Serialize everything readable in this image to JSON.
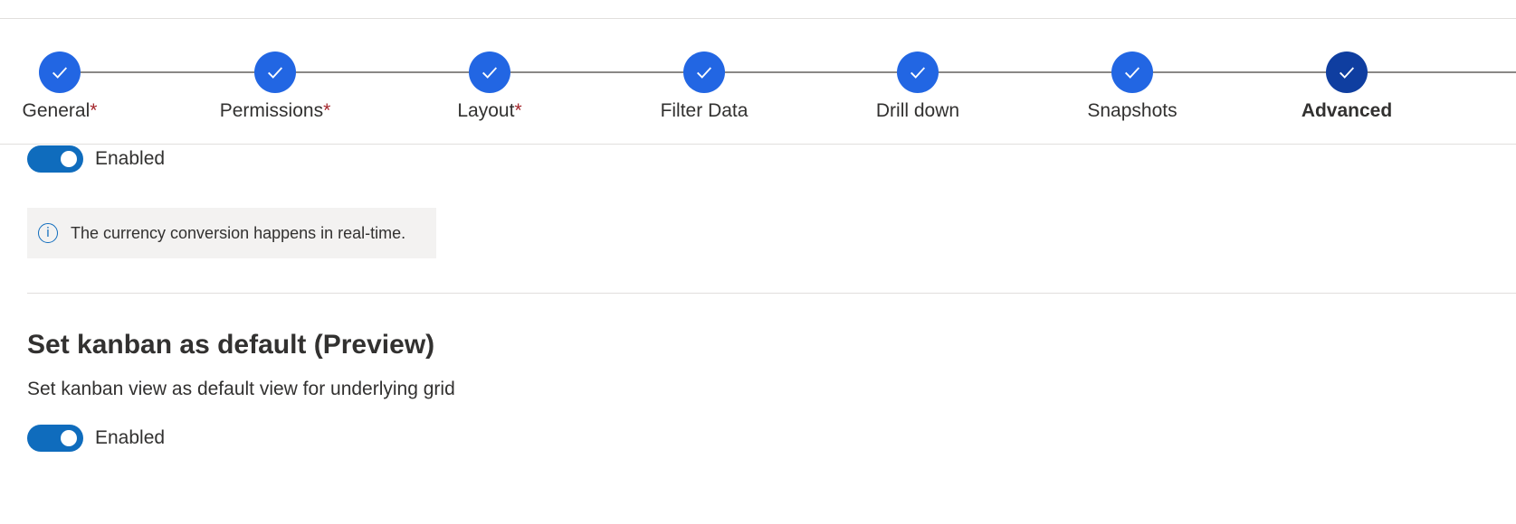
{
  "stepper": {
    "steps": [
      {
        "label": "General",
        "required": "*"
      },
      {
        "label": "Permissions",
        "required": "*"
      },
      {
        "label": "Layout",
        "required": "*"
      },
      {
        "label": "Filter Data",
        "required": ""
      },
      {
        "label": "Drill down",
        "required": ""
      },
      {
        "label": "Snapshots",
        "required": ""
      },
      {
        "label": "Advanced",
        "required": ""
      }
    ],
    "active_step": "Advanced",
    "completed_color": "#2266e3",
    "active_color": "#0f3ea0"
  },
  "currency_section": {
    "toggle_label": "Enabled",
    "toggle_on": true,
    "info_icon": "info-icon",
    "info_message": "The currency conversion happens in real-time."
  },
  "kanban_section": {
    "title": "Set kanban as default (Preview)",
    "description": "Set kanban view as default view for underlying grid",
    "toggle_label": "Enabled",
    "toggle_on": true
  },
  "colors": {
    "toggle_on": "#0f6cbd",
    "required_marker": "#a4262c",
    "info_bar_bg": "#f3f2f1"
  }
}
